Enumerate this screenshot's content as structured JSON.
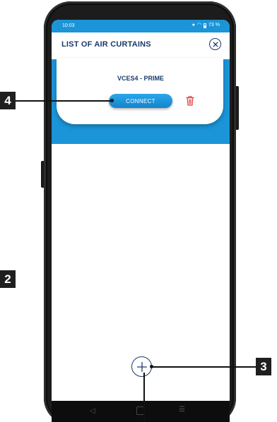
{
  "status_bar": {
    "time": "10:03",
    "battery": "73 %"
  },
  "header": {
    "title": "LIST OF AIR CURTAINS"
  },
  "device_card": {
    "name": "VCES4 - PRIME",
    "connect_label": "CONNECT"
  },
  "callouts": {
    "c2": "2",
    "c3": "3",
    "c4": "4"
  },
  "icons": {
    "close": "close-circle-icon",
    "delete": "trash-icon",
    "add": "plus-circle-icon"
  },
  "colors": {
    "accent": "#1b94d8",
    "title": "#1a3a6b",
    "delete": "#e23a3a"
  }
}
